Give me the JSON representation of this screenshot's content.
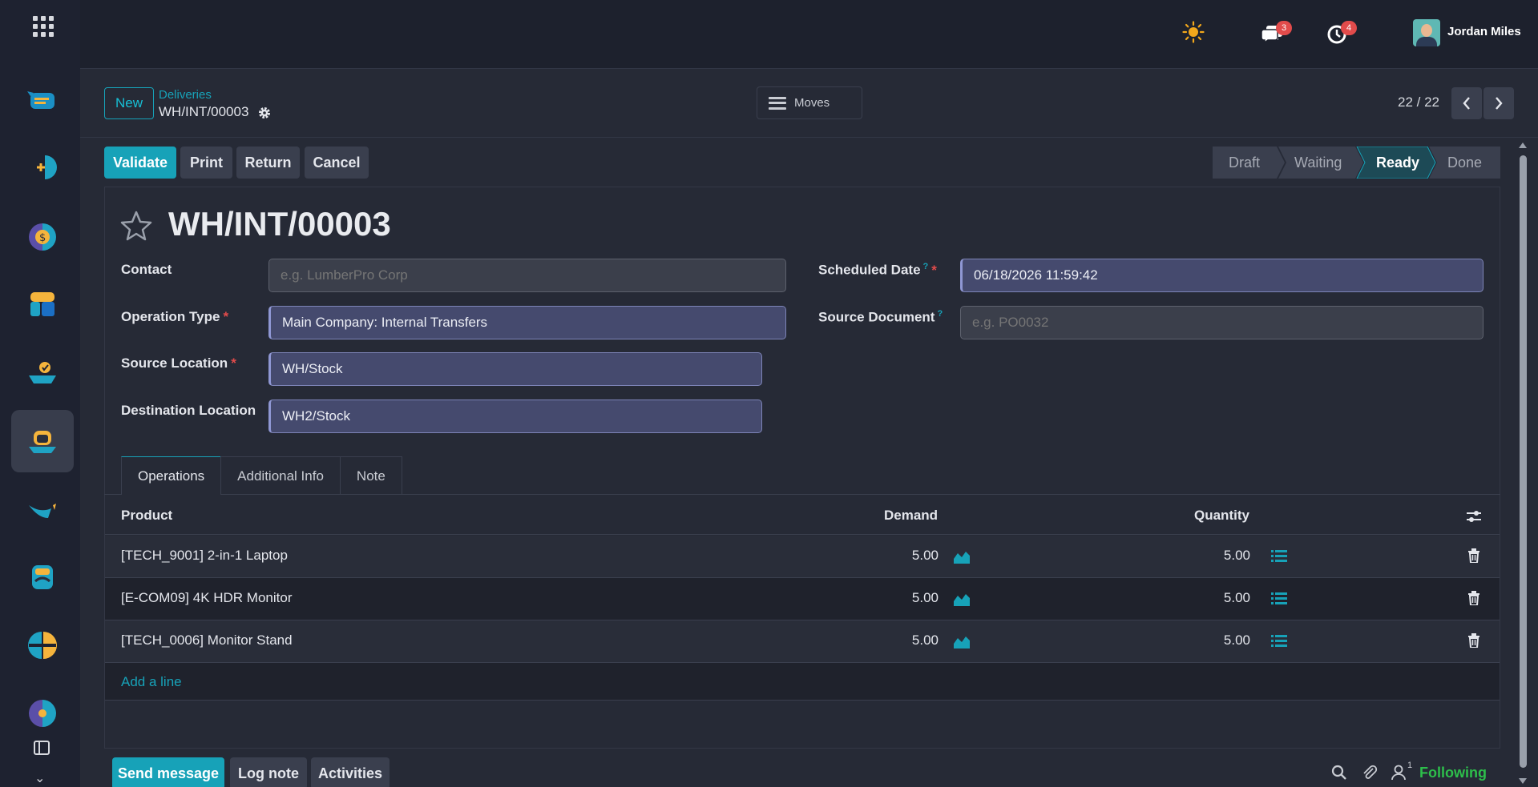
{
  "topbar": {
    "chat_badge": "3",
    "activity_badge": "4",
    "user_name": "Jordan Miles"
  },
  "control": {
    "new_label": "New",
    "breadcrumb_parent": "Deliveries",
    "breadcrumb_current": "WH/INT/00003",
    "moves_label": "Moves",
    "pager": "22 / 22"
  },
  "actions": {
    "validate": "Validate",
    "print": "Print",
    "return": "Return",
    "cancel": "Cancel"
  },
  "statusbar": {
    "steps": [
      "Draft",
      "Waiting",
      "Ready",
      "Done"
    ],
    "active": "Ready"
  },
  "record": {
    "title": "WH/INT/00003",
    "contact_label": "Contact",
    "contact_placeholder": "e.g. LumberPro Corp",
    "operation_type_label": "Operation Type",
    "operation_type_value": "Main Company: Internal Transfers",
    "source_location_label": "Source Location",
    "source_location_value": "WH/Stock",
    "destination_location_label": "Destination Location",
    "destination_location_value": "WH2/Stock",
    "scheduled_date_label": "Scheduled Date",
    "scheduled_date_value": "06/18/2026 11:59:42",
    "source_document_label": "Source Document",
    "source_document_placeholder": "e.g. PO0032",
    "help_mark": "?",
    "required_mark": "*"
  },
  "tabs": [
    "Operations",
    "Additional Info",
    "Note"
  ],
  "table": {
    "headers": {
      "product": "Product",
      "demand": "Demand",
      "quantity": "Quantity"
    },
    "rows": [
      {
        "product": "[TECH_9001] 2-in-1 Laptop",
        "demand": "5.00",
        "quantity": "5.00"
      },
      {
        "product": "[E-COM09] 4K HDR Monitor",
        "demand": "5.00",
        "quantity": "5.00"
      },
      {
        "product": "[TECH_0006] Monitor Stand",
        "demand": "5.00",
        "quantity": "5.00"
      }
    ],
    "add_line": "Add a line"
  },
  "chatter": {
    "send_message": "Send message",
    "log_note": "Log note",
    "activities": "Activities",
    "followers_count": "1",
    "following": "Following"
  },
  "colors": {
    "accent": "#17a2b8",
    "required": "#e24b4b",
    "following": "#2dbf4b",
    "background": "#262a36"
  }
}
